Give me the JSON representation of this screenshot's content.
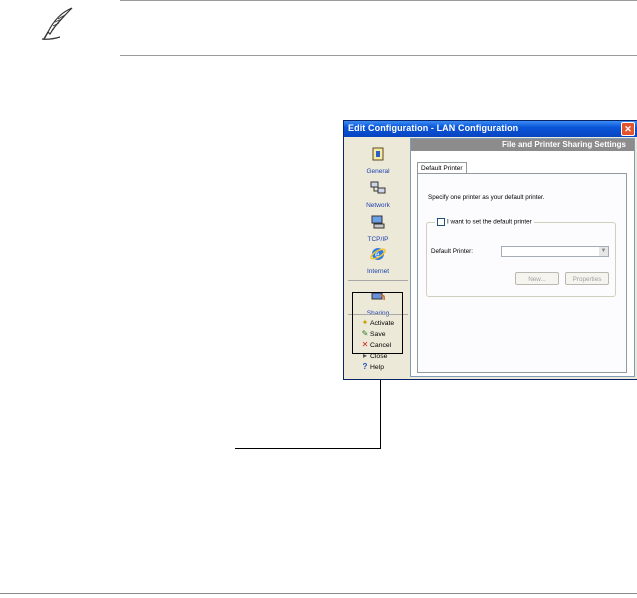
{
  "window": {
    "title": "Edit Configuration - LAN Configuration",
    "close_glyph": "✕"
  },
  "sidebar": {
    "items": [
      {
        "label": "General",
        "icon": "general-icon"
      },
      {
        "label": "Network",
        "icon": "network-icon"
      },
      {
        "label": "TCP/IP",
        "icon": "tcpip-icon"
      },
      {
        "label": "Internet",
        "icon": "internet-icon"
      },
      {
        "label": "Sharing",
        "icon": "sharing-icon"
      }
    ],
    "actions": [
      {
        "label": "Activate",
        "icon": "activate-icon"
      },
      {
        "label": "Save",
        "icon": "save-icon"
      },
      {
        "label": "Cancel",
        "icon": "cancel-icon"
      },
      {
        "label": "Close",
        "icon": "close-icon"
      },
      {
        "label": "Help",
        "icon": "help-icon"
      }
    ]
  },
  "panel": {
    "header": "File and Printer Sharing Settings",
    "tab": "Default Printer",
    "instruction": "Specify one printer as your default printer.",
    "checkbox_label": "I want to set the default printer",
    "checkbox_checked": false,
    "default_printer_label": "Default Printer:",
    "default_printer_value": "",
    "new_button": "New...",
    "properties_button": "Properties"
  },
  "colors": {
    "titlebar": "#0a55d8",
    "panel_header": "#8c8c8c",
    "window_bg": "#ece9d8"
  }
}
